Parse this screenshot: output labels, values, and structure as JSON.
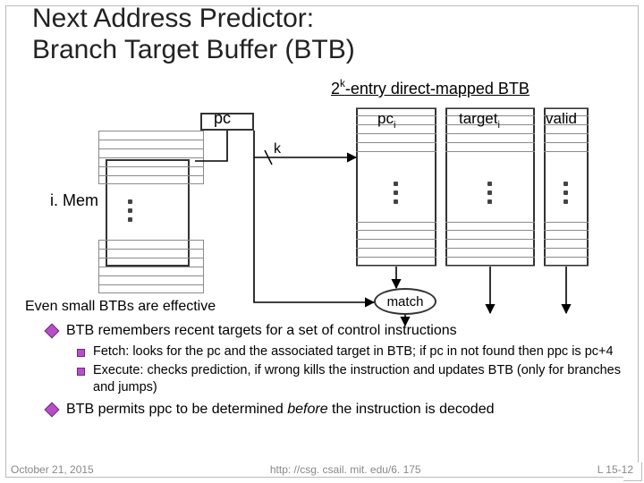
{
  "title_line1": "Next Address Predictor:",
  "title_line2": "Branch Target Buffer (BTB)",
  "subtitle_pre": "2",
  "subtitle_sup": "k",
  "subtitle_post": "-entry direct-mapped BTB",
  "labels": {
    "pc": "pc",
    "k": "k",
    "imem": "i. Mem",
    "pci_pre": "pc",
    "pci_sub": "i",
    "target_pre": "target",
    "target_sub": "i",
    "valid": "valid",
    "match": "match"
  },
  "note_effective": "Even small BTBs are effective",
  "bullet1": "BTB remembers recent targets for a set of control instructions",
  "bullet2a": "Fetch: looks for the pc and the associated target in BTB; if pc in not found then ppc is pc+4",
  "bullet2b": "Execute: checks prediction, if wrong kills the instruction and updates BTB (only for branches and jumps)",
  "bullet3_pre": "BTB permits ppc to be determined ",
  "bullet3_em": "before",
  "bullet3_post": " the instruction is decoded",
  "footer": {
    "date": "October 21, 2015",
    "url": "http: //csg. csail. mit. edu/6. 175",
    "page": "L 15-12"
  }
}
